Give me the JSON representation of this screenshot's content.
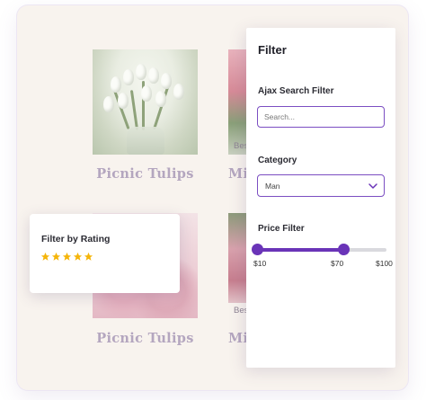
{
  "products": [
    {
      "title": "Picnic Tulips"
    },
    {
      "title": "Mi"
    },
    {
      "title": "Picnic Tulips"
    },
    {
      "title": "Mi"
    }
  ],
  "badges": [
    "Bes",
    "Bes"
  ],
  "rating_card": {
    "title": "Filter by Rating",
    "stars": 5,
    "star_color": "#f5b50a",
    "star_icon": "star-icon"
  },
  "filter": {
    "title": "Filter",
    "search": {
      "label": "Ajax Search Filter",
      "placeholder": "Search..."
    },
    "category": {
      "label": "Category",
      "selected": "Man"
    },
    "price": {
      "label": "Price Filter",
      "min": 10,
      "max": 100,
      "selected_min": 10,
      "selected_max": 70,
      "min_label": "$10",
      "mid_label": "$70",
      "max_label": "$100"
    },
    "accent_color": "#6a34b8"
  }
}
